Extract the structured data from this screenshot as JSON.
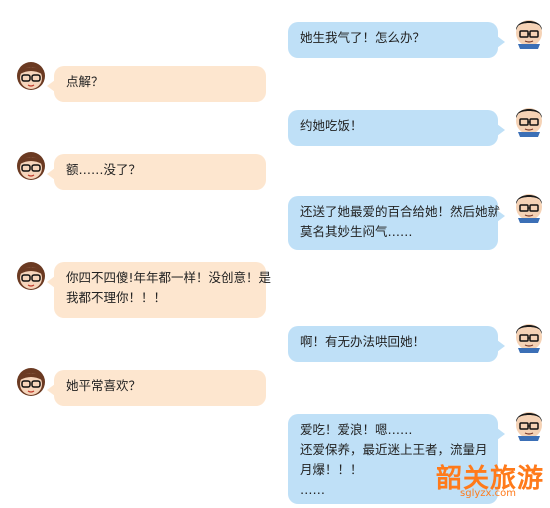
{
  "messages": [
    {
      "side": "right",
      "lines": [
        "她生我气了！怎么办？"
      ]
    },
    {
      "side": "left",
      "lines": [
        "点解？"
      ]
    },
    {
      "side": "right",
      "lines": [
        "约她吃饭！"
      ]
    },
    {
      "side": "left",
      "lines": [
        "额……没了？"
      ]
    },
    {
      "side": "right",
      "lines": [
        "还送了她最爱的百合给她！然后她就",
        "莫名其妙生闷气……"
      ]
    },
    {
      "side": "left",
      "lines": [
        "你四不四傻!年年都一样！没创意！是",
        "我都不理你！！！"
      ]
    },
    {
      "side": "right",
      "lines": [
        "啊！有无办法哄回她！"
      ]
    },
    {
      "side": "left",
      "lines": [
        "她平常喜欢？"
      ]
    },
    {
      "side": "right",
      "lines": [
        "爱吃！爱浪！嗯……",
        "还爱保养，最近迷上王者，流量月",
        "月爆！！！",
        "……"
      ]
    }
  ],
  "watermark": {
    "brand": "韶关旅游",
    "url": "sglyzx.com"
  },
  "colors": {
    "left_bubble": "#fde6cf",
    "right_bubble": "#bfe0f7",
    "watermark": "#ff7a1a"
  }
}
